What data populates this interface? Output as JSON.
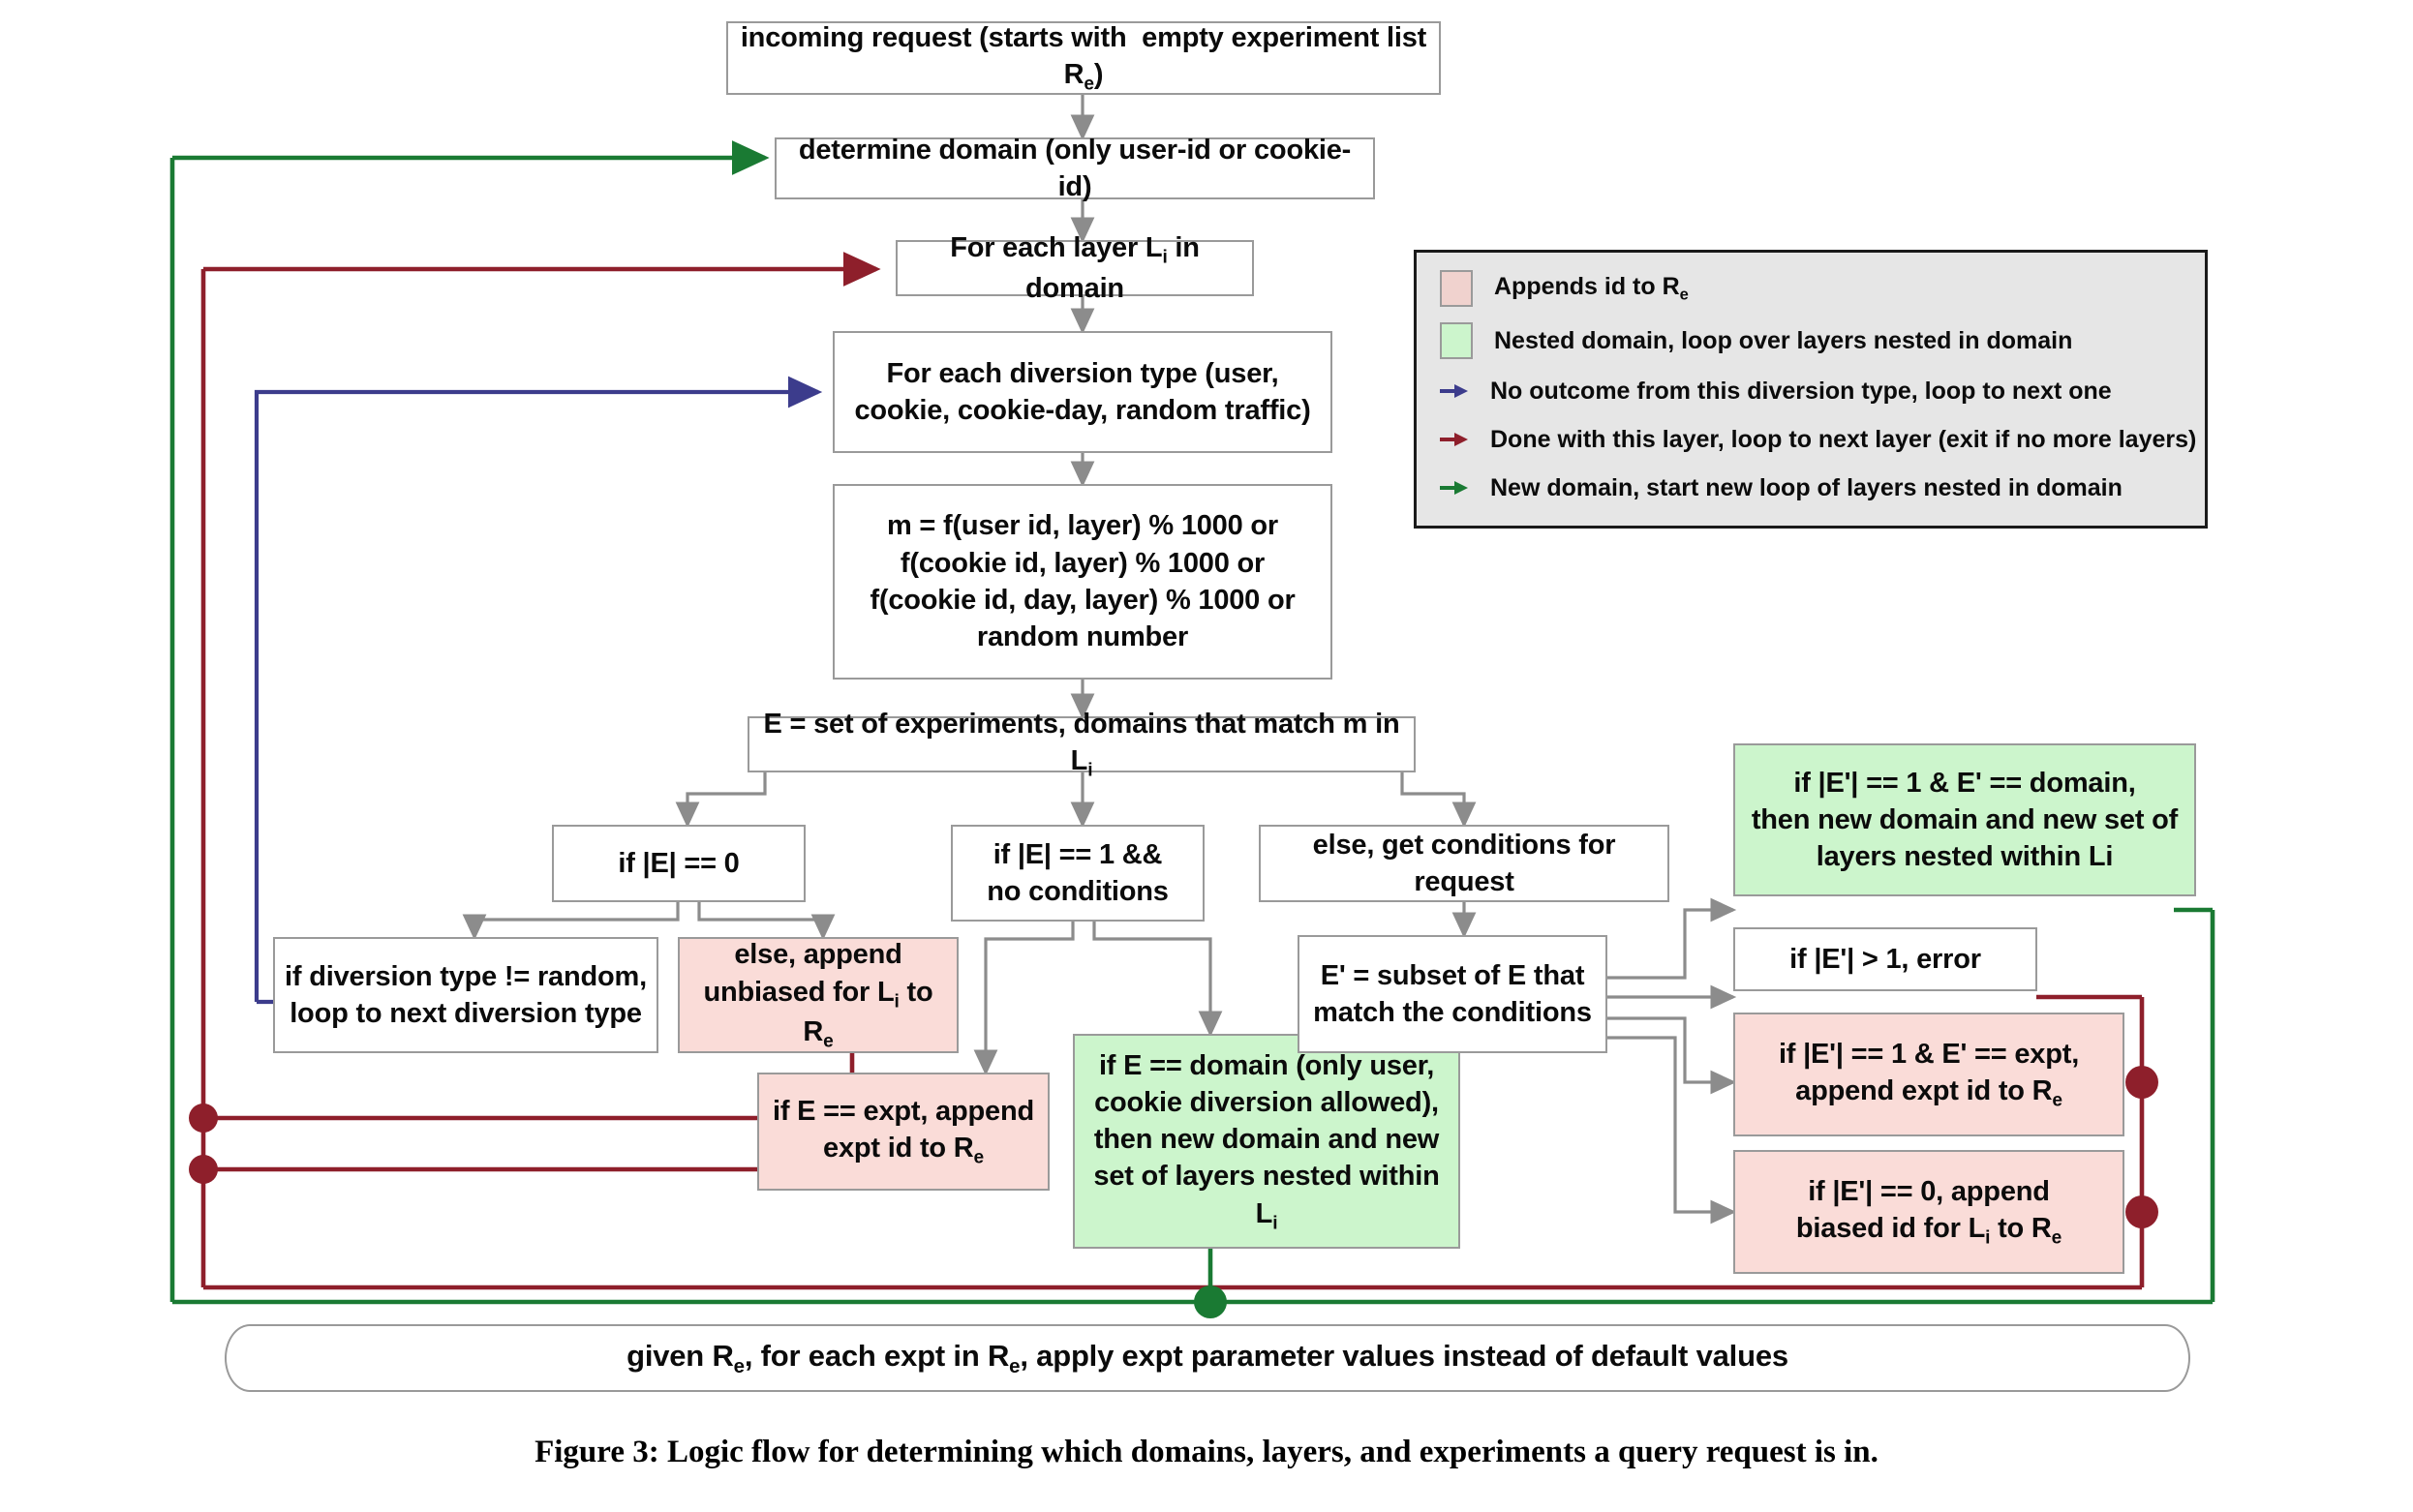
{
  "figure": {
    "caption": "Figure 3: Logic flow for determining which domains, layers, and experiments a query request is in."
  },
  "nodes": {
    "incoming_request": "incoming request (starts with  empty experiment list Rₑ)",
    "determine_domain": "determine domain (only user-id or cookie-id)",
    "for_each_layer": "For each layer Lᵢ in domain",
    "for_each_diversion": "For each diversion type (user, cookie, cookie-day, random traffic)",
    "m_formula": "m = f(user id, layer) % 1000 or f(cookie id, layer) % 1000 or f(cookie id, day, layer) % 1000 or random number",
    "e_set": "E = set of experiments, domains that match m in Lᵢ",
    "if_e_zero": "if |E| == 0",
    "if_e_one": "if |E| == 1 && no conditions",
    "else_conditions": "else, get conditions for request",
    "if_diversion_not_random": "if diversion type != random, loop to next diversion type",
    "else_append_unbiased": "else, append unbiased for Lᵢ to Rₑ",
    "if_e_expt": "if E == expt, append expt id to Rₑ",
    "if_e_domain": "if E == domain (only user, cookie diversion allowed), then new domain and new set of layers nested within Lᵢ",
    "e_prime_subset": "E' = subset of E that match the conditions",
    "if_ep_one_domain": "if |E'| == 1 & E' == domain, then new domain and new set of layers nested within Li",
    "if_ep_gt_one": "if |E'| > 1, error",
    "if_ep_one_expt": "if |E'| == 1 & E' == expt, append expt id to Rₑ",
    "if_ep_zero": "if |E'| == 0, append biased id for Lᵢ to Rₑ",
    "final": "given Rₑ, for each expt in Rₑ, apply expt parameter values instead of default values"
  },
  "legend": {
    "items": [
      {
        "kind": "swatch-pink",
        "icon": "pink-square-swatch",
        "label": "Appends id to Rₑ"
      },
      {
        "kind": "swatch-green",
        "icon": "green-square-swatch",
        "label": "Nested domain, loop over layers nested in domain"
      },
      {
        "kind": "arrow-blue",
        "icon": "blue-arrow-icon",
        "label": "No outcome from this diversion type, loop to next one"
      },
      {
        "kind": "arrow-red",
        "icon": "red-arrow-icon",
        "label": "Done with this layer, loop to next layer (exit if no more layers)"
      },
      {
        "kind": "arrow-green",
        "icon": "green-arrow-icon",
        "label": "New domain, start new loop of layers nested in domain"
      }
    ]
  },
  "colors": {
    "pink_fill": "#fadcd8",
    "green_fill": "#ccf5cc",
    "legend_bg": "#e6e6e6",
    "box_border": "#9a9a9a",
    "arrow_gray": "#8c8c8c",
    "loop_red": "#8e1f2b",
    "loop_green": "#1a7a33",
    "loop_blue": "#3c3c8c"
  }
}
